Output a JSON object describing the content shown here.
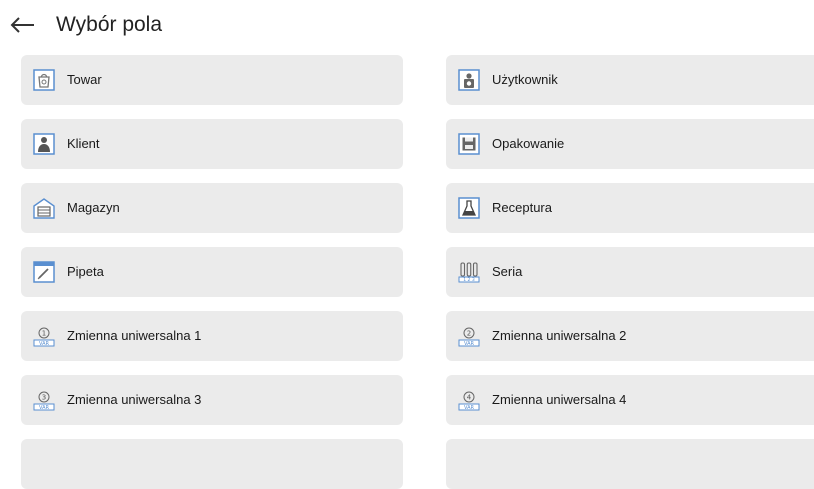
{
  "header": {
    "title": "Wybór pola"
  },
  "tiles": [
    {
      "label": "Towar",
      "icon": "product-bag-icon"
    },
    {
      "label": "Użytkownik",
      "icon": "user-weight-icon"
    },
    {
      "label": "Klient",
      "icon": "client-person-icon"
    },
    {
      "label": "Opakowanie",
      "icon": "packaging-box-icon"
    },
    {
      "label": "Magazyn",
      "icon": "warehouse-icon"
    },
    {
      "label": "Receptura",
      "icon": "recipe-flask-icon"
    },
    {
      "label": "Pipeta",
      "icon": "pipette-icon"
    },
    {
      "label": "Seria",
      "icon": "series-tubes-icon"
    },
    {
      "label": "Zmienna uniwersalna 1",
      "icon": "variable-1-icon"
    },
    {
      "label": "Zmienna uniwersalna 2",
      "icon": "variable-2-icon"
    },
    {
      "label": "Zmienna uniwersalna 3",
      "icon": "variable-3-icon"
    },
    {
      "label": "Zmienna uniwersalna 4",
      "icon": "variable-4-icon"
    },
    {
      "label": ""
    },
    {
      "label": ""
    }
  ]
}
